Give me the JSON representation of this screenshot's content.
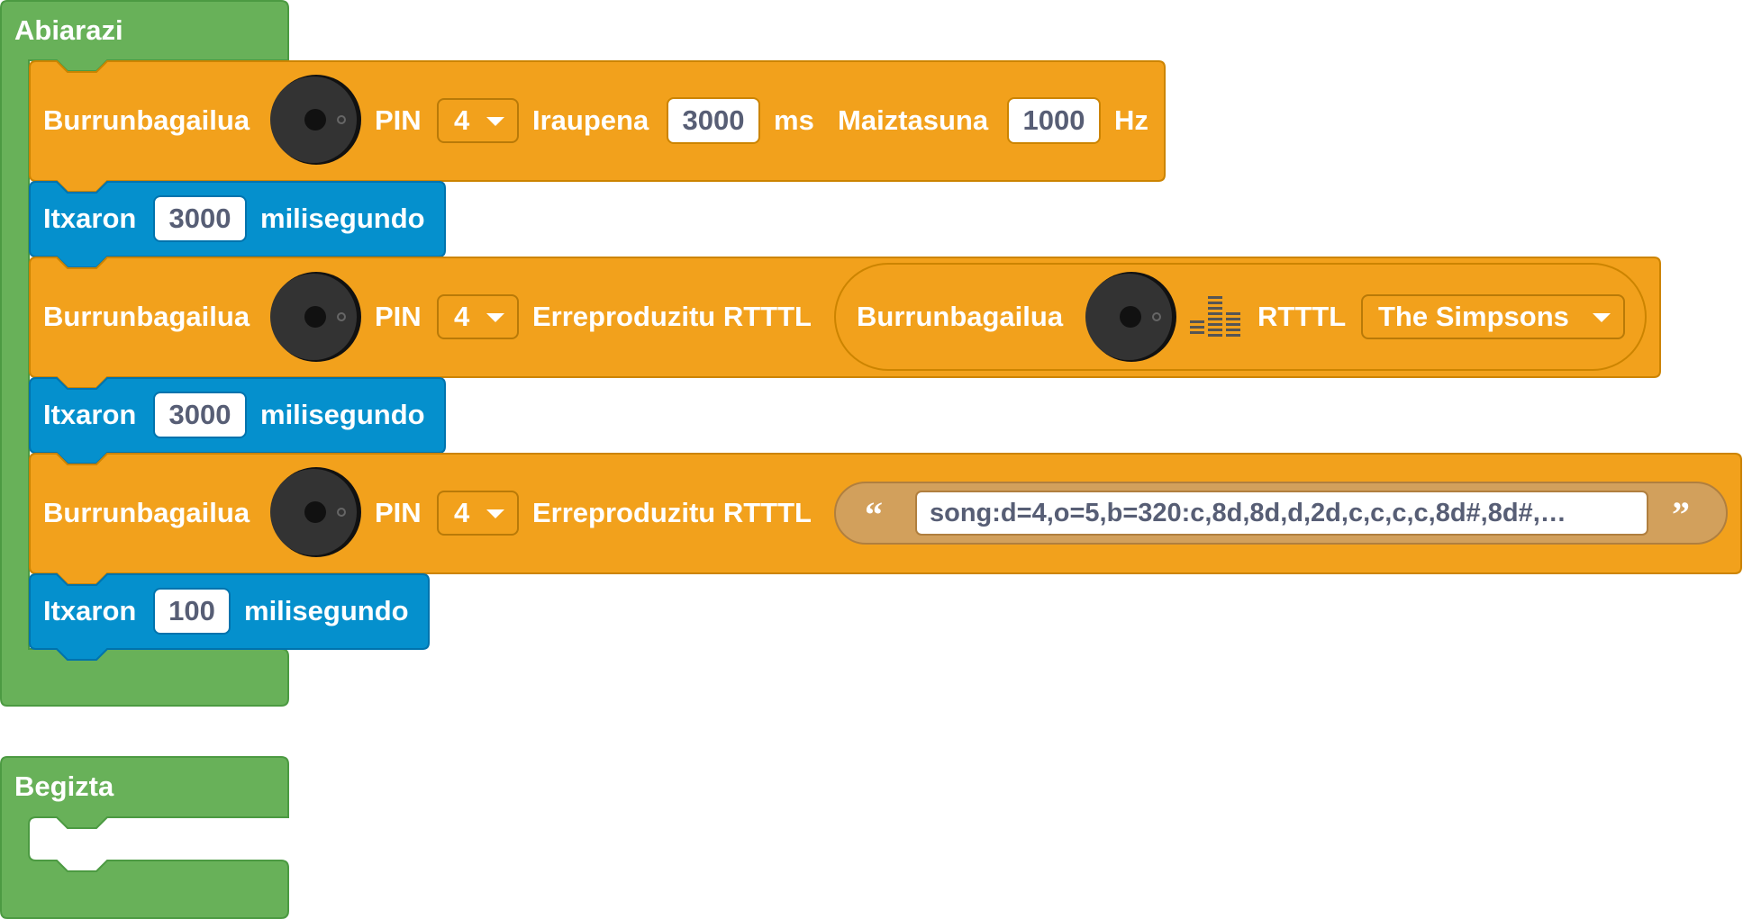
{
  "colors": {
    "event_green": "#68b159",
    "sound_orange": "#f2a11c",
    "control_blue": "#0590cd",
    "string_tan": "#d2a05c",
    "buzzer_dark": "#333333"
  },
  "setup_block": {
    "title": "Abiarazi",
    "tone_block": {
      "label": "Burrunbagailua",
      "icon": "buzzer-icon",
      "pin_label": "PIN",
      "pin_value": "4",
      "duration_label": "Iraupena",
      "duration_value": "3000",
      "duration_unit": "ms",
      "frequency_label": "Maiztasuna",
      "frequency_value": "1000",
      "frequency_unit": "Hz"
    },
    "wait_1": {
      "label": "Itxaron",
      "value": "3000",
      "unit": "milisegundo"
    },
    "rtttl_block_1": {
      "label": "Burrunbagailua",
      "icon": "buzzer-icon",
      "pin_label": "PIN",
      "pin_value": "4",
      "action_label": "Erreproduzitu RTTTL",
      "song_reporter": {
        "label": "Burrunbagailua",
        "icon": "buzzer-icon",
        "music_icon": "equalizer-icon",
        "rtttl_label": "RTTTL",
        "song_value": "The Simpsons"
      }
    },
    "wait_2": {
      "label": "Itxaron",
      "value": "3000",
      "unit": "milisegundo"
    },
    "rtttl_block_2": {
      "label": "Burrunbagailua",
      "icon": "buzzer-icon",
      "pin_label": "PIN",
      "pin_value": "4",
      "action_label": "Erreproduzitu RTTTL",
      "open_quote": "“",
      "close_quote": "”",
      "string_value": "song:d=4,o=5,b=320:c,8d,8d,d,2d,c,c,c,c,8d#,8d#,…"
    },
    "wait_3": {
      "label": "Itxaron",
      "value": "100",
      "unit": "milisegundo"
    }
  },
  "loop_block": {
    "title": "Begizta"
  }
}
